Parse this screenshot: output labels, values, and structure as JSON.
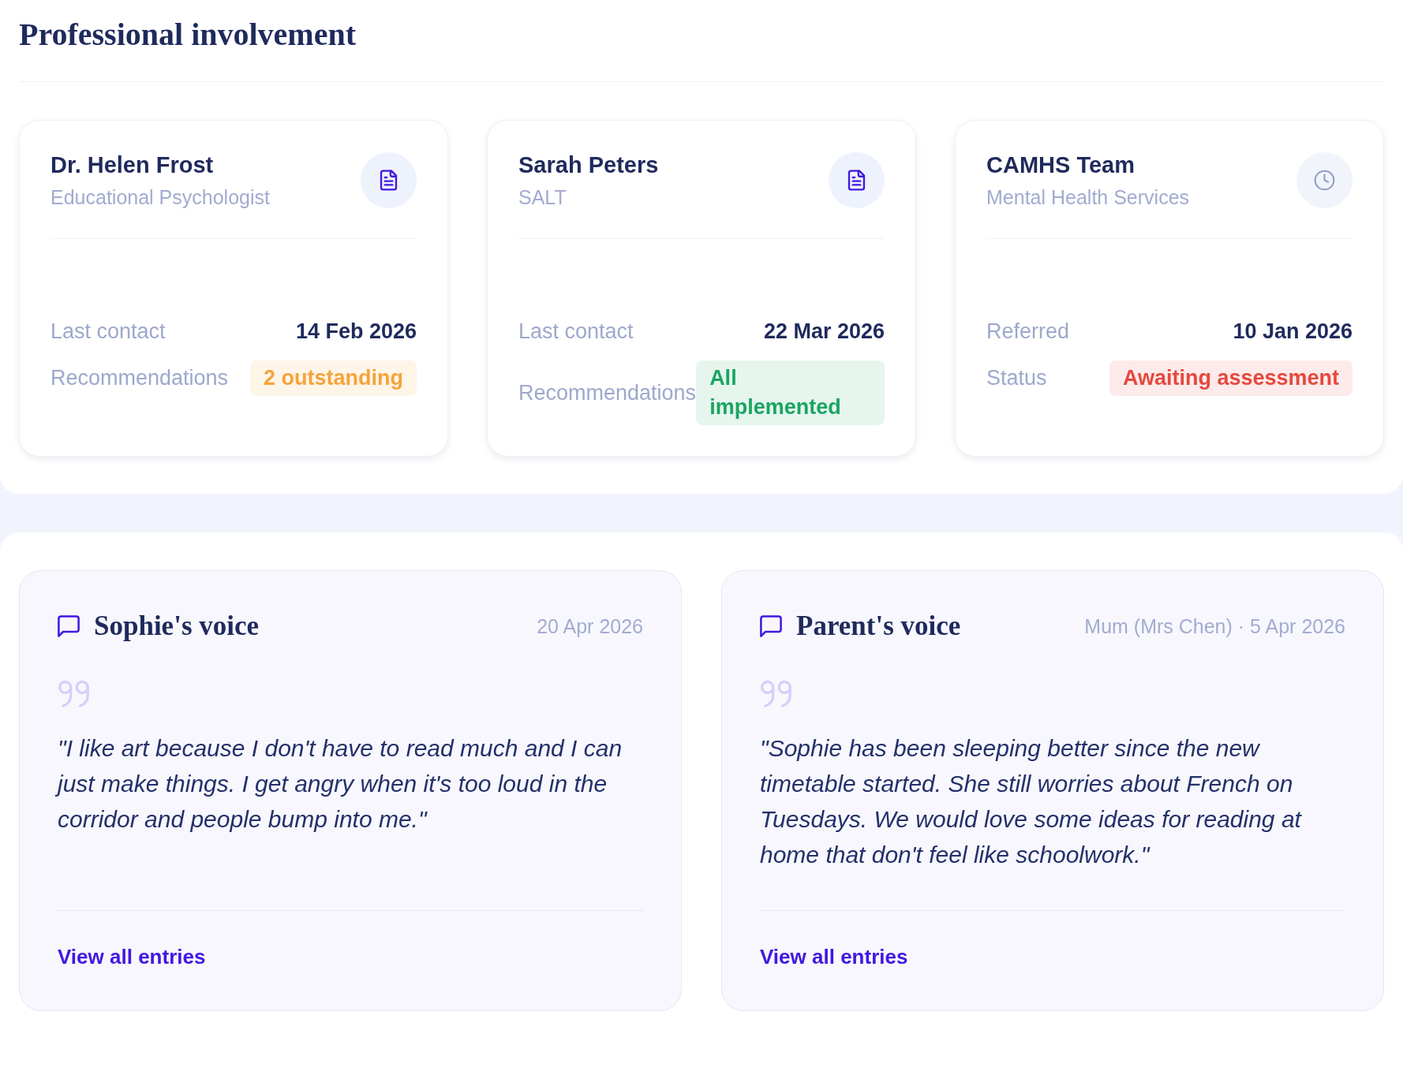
{
  "section_title": "Professional involvement",
  "professionals": [
    {
      "name": "Dr. Helen Frost",
      "role": "Educational Psychologist",
      "kind": "report",
      "details": [
        {
          "label": "Last contact",
          "value": "14 Feb 2026",
          "kind": "date"
        },
        {
          "label": "Recommendations",
          "value": "2 outstanding",
          "kind": "badge",
          "color": "#f5a33a"
        }
      ]
    },
    {
      "name": "Sarah Peters",
      "role": "SALT",
      "kind": "report",
      "details": [
        {
          "label": "Last contact",
          "value": "22 Mar 2026",
          "kind": "date"
        },
        {
          "label": "Recommendations",
          "value": "All implemented",
          "kind": "badge",
          "color": "#1aa561"
        }
      ]
    },
    {
      "name": "CAMHS Team",
      "role": "Mental Health Services",
      "kind": "referral",
      "details": [
        {
          "label": "Referred",
          "value": "10 Jan 2026",
          "kind": "date"
        },
        {
          "label": "Status",
          "value": "Awaiting assessment",
          "kind": "badge",
          "color": "#e5483e"
        }
      ]
    }
  ],
  "voices": [
    {
      "title": "Sophie's voice",
      "meta": "20 Apr 2026",
      "quote": "\"I like art because I don't have to read much and I can just make things. I get angry when it's too loud in the corridor and people bump into me.\"",
      "link": "View all entries"
    },
    {
      "title": "Parent's voice",
      "meta": "Mum (Mrs Chen) · 5 Apr 2026",
      "quote": "\"Sophie has been sleeping better since the new timetable started. She still worries about French on Tuesdays. We would love some ideas for reading at home that don't feel like schoolwork.\"",
      "link": "View all entries"
    }
  ]
}
